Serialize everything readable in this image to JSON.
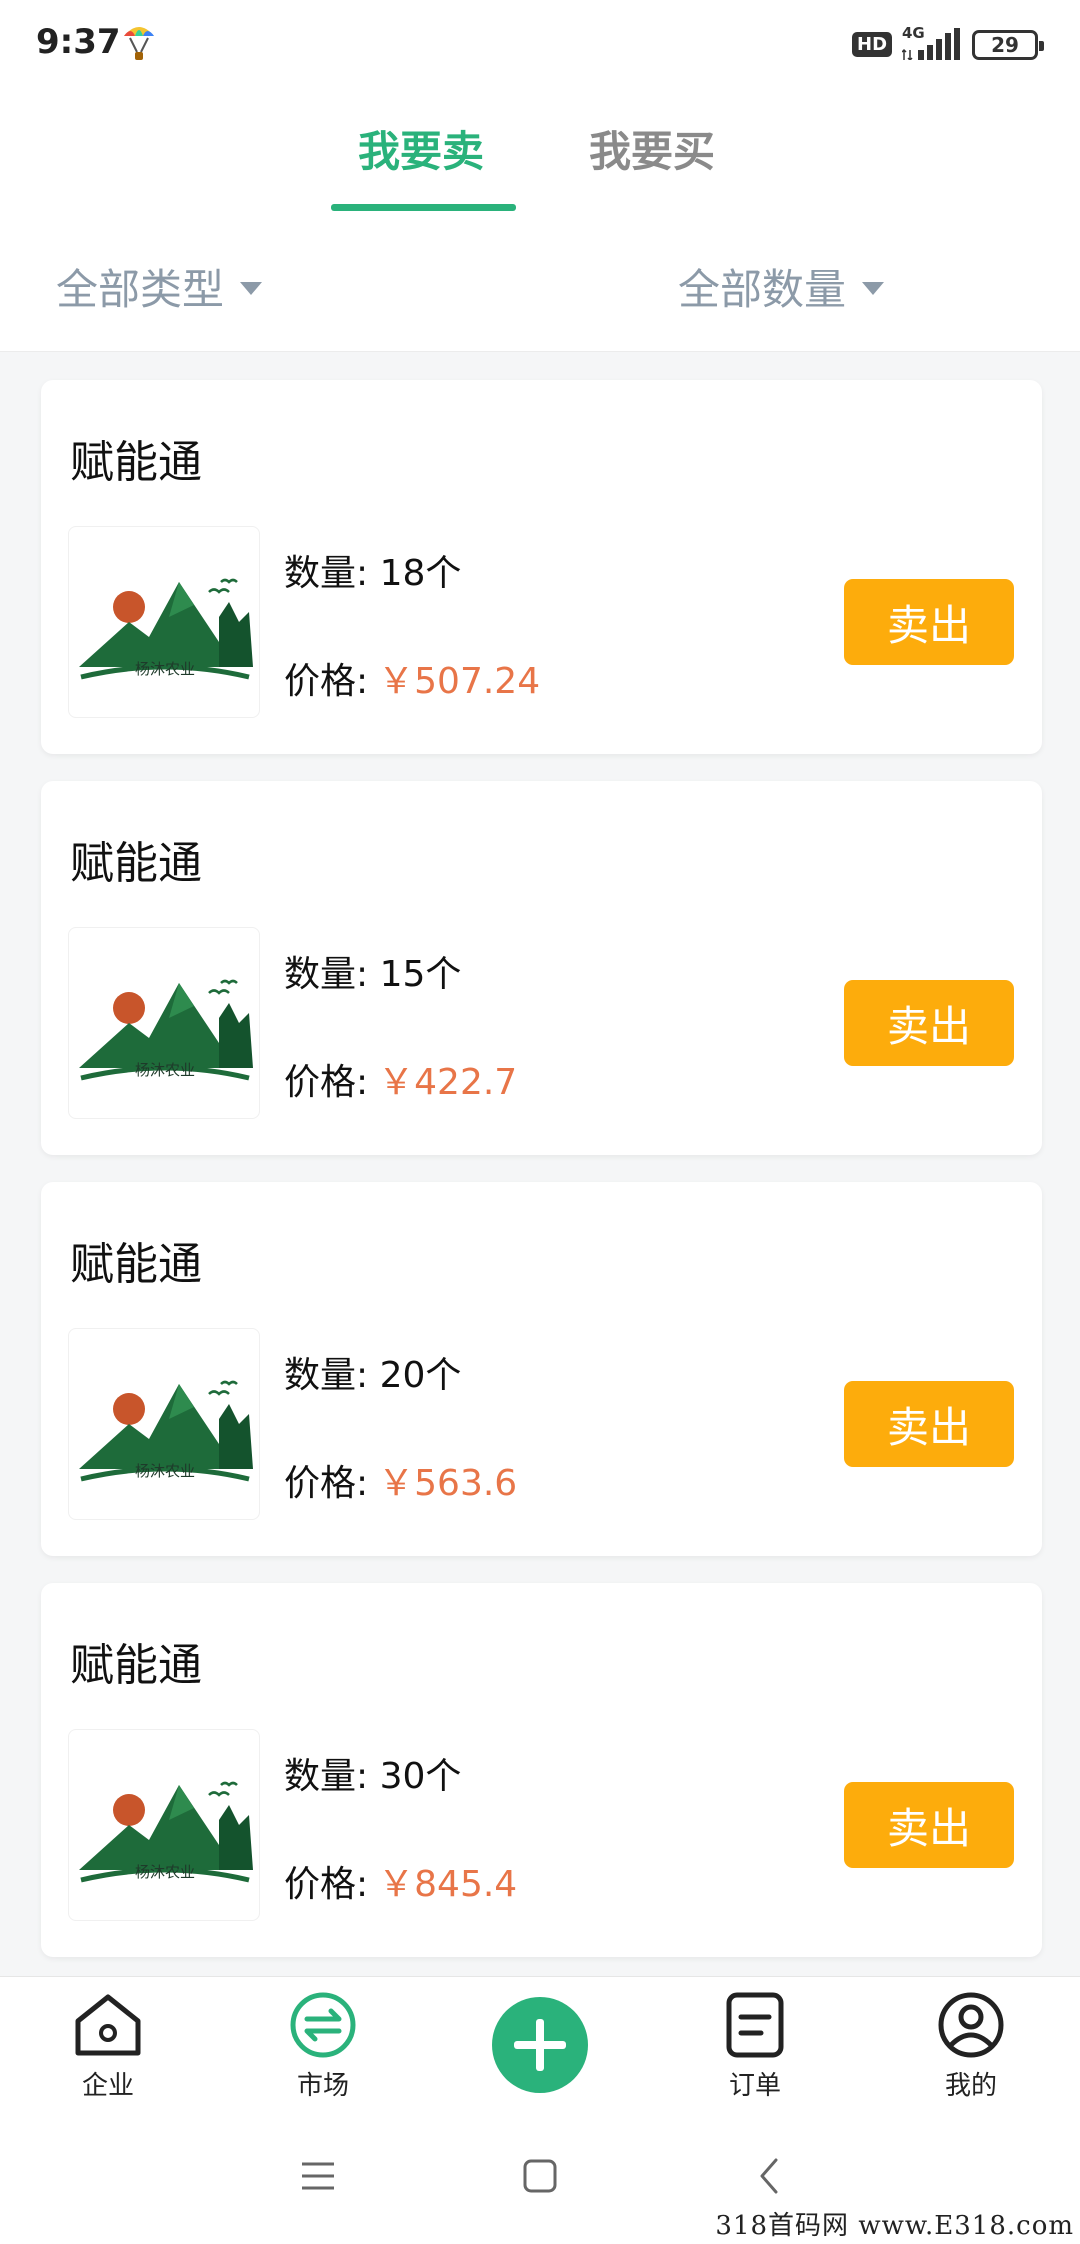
{
  "status": {
    "time": "9:37",
    "hd": "HD",
    "network": "4G",
    "battery": "29"
  },
  "tabs": {
    "sell": "我要卖",
    "buy": "我要买"
  },
  "filters": {
    "type": "全部类型",
    "quantity": "全部数量"
  },
  "listings": [
    {
      "title": "赋能通",
      "qty_label": "数量:",
      "qty": "18个",
      "price_label": "价格:",
      "price": "￥507.24",
      "button": "卖出"
    },
    {
      "title": "赋能通",
      "qty_label": "数量:",
      "qty": "15个",
      "price_label": "价格:",
      "price": "￥422.7",
      "button": "卖出"
    },
    {
      "title": "赋能通",
      "qty_label": "数量:",
      "qty": "20个",
      "price_label": "价格:",
      "price": "￥563.6",
      "button": "卖出"
    },
    {
      "title": "赋能通",
      "qty_label": "数量:",
      "qty": "30个",
      "price_label": "价格:",
      "price": "￥845.4",
      "button": "卖出"
    }
  ],
  "logo_text": "杨沐农业",
  "nav": {
    "qiye": "企业",
    "shichang": "市场",
    "dingdan": "订单",
    "wode": "我的"
  },
  "colors": {
    "accent": "#2ab27b",
    "button": "#fdac0c",
    "price": "#e87548"
  },
  "watermark": "318首码网 www.E318.com"
}
